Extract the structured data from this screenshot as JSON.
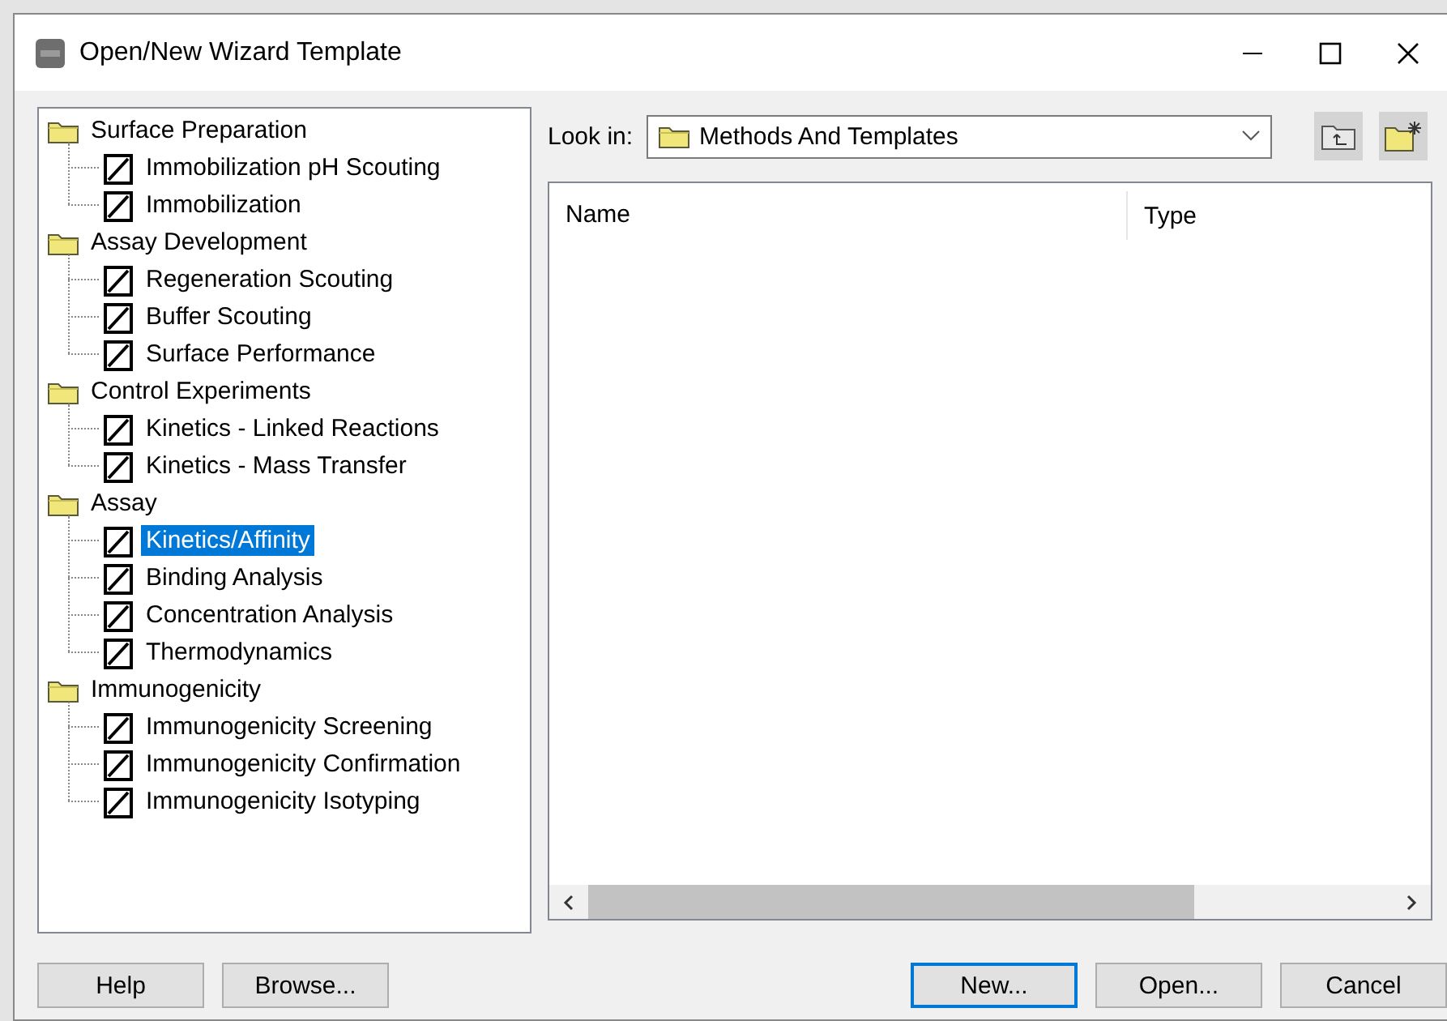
{
  "window": {
    "title": "Open/New Wizard Template"
  },
  "tree": [
    {
      "label": "Surface Preparation",
      "children": [
        {
          "label": "Immobilization pH Scouting",
          "selected": false
        },
        {
          "label": "Immobilization",
          "selected": false
        }
      ]
    },
    {
      "label": "Assay Development",
      "children": [
        {
          "label": "Regeneration Scouting",
          "selected": false
        },
        {
          "label": "Buffer Scouting",
          "selected": false
        },
        {
          "label": "Surface Performance",
          "selected": false
        }
      ]
    },
    {
      "label": "Control Experiments",
      "children": [
        {
          "label": "Kinetics - Linked Reactions",
          "selected": false
        },
        {
          "label": "Kinetics - Mass Transfer",
          "selected": false
        }
      ]
    },
    {
      "label": "Assay",
      "children": [
        {
          "label": "Kinetics/Affinity",
          "selected": true
        },
        {
          "label": "Binding Analysis",
          "selected": false
        },
        {
          "label": "Concentration Analysis",
          "selected": false
        },
        {
          "label": "Thermodynamics",
          "selected": false
        }
      ]
    },
    {
      "label": "Immunogenicity",
      "children": [
        {
          "label": "Immunogenicity Screening",
          "selected": false
        },
        {
          "label": "Immunogenicity Confirmation",
          "selected": false
        },
        {
          "label": "Immunogenicity Isotyping",
          "selected": false
        }
      ]
    }
  ],
  "look_in": {
    "label": "Look in:",
    "value": "Methods And Templates"
  },
  "file_list": {
    "columns": [
      "Name",
      "Type"
    ]
  },
  "buttons_left": [
    {
      "label": "Help",
      "focused": false
    },
    {
      "label": "Browse...",
      "focused": false
    }
  ],
  "buttons_right": [
    {
      "label": "New...",
      "focused": true
    },
    {
      "label": "Open...",
      "focused": false
    },
    {
      "label": "Cancel",
      "focused": false
    }
  ]
}
